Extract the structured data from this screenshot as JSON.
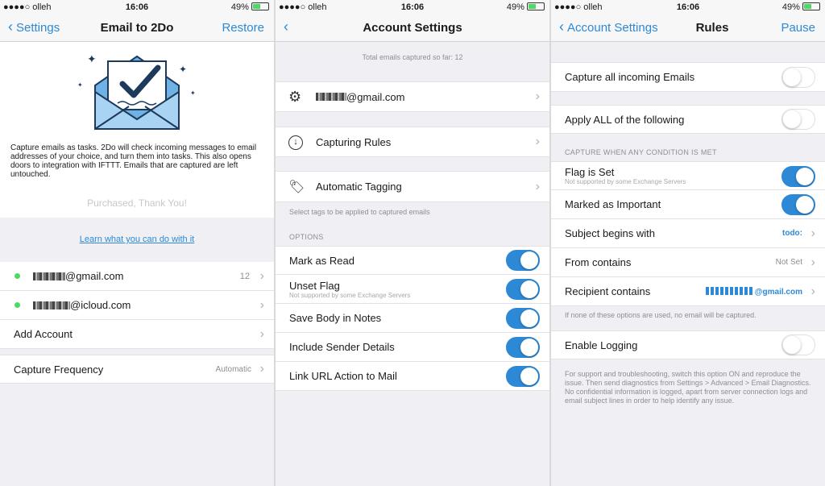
{
  "status": {
    "carrier": "●●●●○ olleh",
    "time": "16:06",
    "battery": "49%"
  },
  "p1": {
    "title": "Email to 2Do",
    "back": "Settings",
    "restore": "Restore",
    "description": "Capture emails as tasks. 2Do will check incoming messages to email addresses of your choice, and turn them into tasks. This also opens doors to integration with IFTTT. Emails that are captured are left untouched.",
    "purchased": "Purchased, Thank You!",
    "learn_link": "Learn what you can do with it",
    "accounts": [
      {
        "email": "@gmail.com",
        "count": "12"
      },
      {
        "email": "@icloud.com",
        "count": ""
      }
    ],
    "add_account": "Add Account",
    "capture_frequency": "Capture Frequency",
    "capture_frequency_value": "Automatic"
  },
  "p2": {
    "title": "Account Settings",
    "total_captured": "Total emails captured so far: 12",
    "account_email": "@gmail.com",
    "capturing_rules": "Capturing Rules",
    "automatic_tagging": "Automatic Tagging",
    "tagging_note": "Select tags to be applied to captured emails",
    "options_header": "OPTIONS",
    "options": [
      {
        "label": "Mark as Read",
        "sub": "",
        "on": true
      },
      {
        "label": "Unset Flag",
        "sub": "Not supported by some Exchange Servers",
        "on": true
      },
      {
        "label": "Save Body in Notes",
        "sub": "",
        "on": true
      },
      {
        "label": "Include Sender Details",
        "sub": "",
        "on": true
      },
      {
        "label": "Link URL Action to Mail",
        "sub": "",
        "on": true
      }
    ]
  },
  "p3": {
    "title": "Rules",
    "back": "Account Settings",
    "pause": "Pause",
    "capture_all": "Capture all incoming Emails",
    "apply_all": "Apply ALL of the following",
    "condition_header": "CAPTURE WHEN ANY CONDITION IS MET",
    "flag_is_set": "Flag is Set",
    "flag_sub": "Not supported by some Exchange Servers",
    "marked_important": "Marked as Important",
    "subject_begins": "Subject begins with",
    "subject_value": "todo:",
    "from_contains": "From contains",
    "from_value": "Not Set",
    "recipient_contains": "Recipient contains",
    "recipient_value": "@gmail.com",
    "none_note": "If none of these options are used, no email will be captured.",
    "enable_logging": "Enable Logging",
    "logging_note": "For support and troubleshooting, switch this option ON and reproduce the issue. Then send diagnostics from Settings > Advanced > Email Diagnostics. No confidential information is logged, apart from server connection logs and email subject lines in order to help identify any issue."
  },
  "colors": {
    "accent": "#2d89d6",
    "green": "#4cd964"
  }
}
